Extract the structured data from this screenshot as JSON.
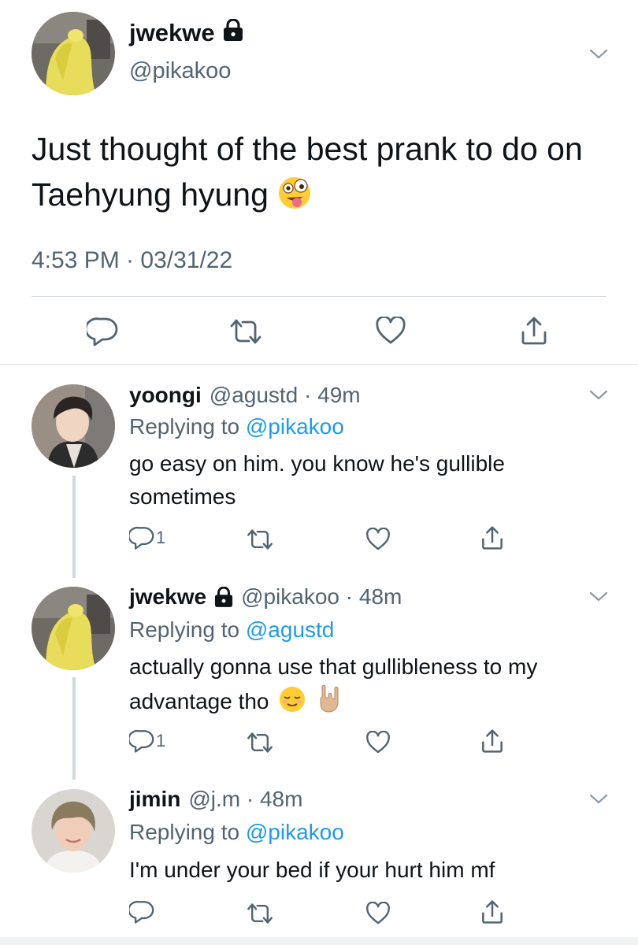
{
  "main_tweet": {
    "display_name": "jwekwe",
    "handle": "@pikakoo",
    "text": "Just thought of the best prank to do on Taehyung hyung",
    "emoji": "zany-face",
    "timestamp": "4:53 PM · 03/31/22"
  },
  "replies": [
    {
      "display_name": "yoongi",
      "handle_meta": "@agustd · 49m",
      "replying_prefix": "Replying to",
      "replying_to": "@pikakoo",
      "text": "go easy on him. you know he's gullible sometimes",
      "reply_count": "1"
    },
    {
      "display_name": "jwekwe",
      "handle_meta": "@pikakoo · 48m",
      "replying_prefix": "Replying to",
      "replying_to": "@agustd",
      "text": "actually gonna use that gullibleness to my advantage tho",
      "reply_count": "1"
    },
    {
      "display_name": "jimin",
      "handle_meta": "@j.m · 48m",
      "replying_prefix": "Replying to",
      "replying_to": "@pikakoo",
      "text": "I'm under your bed if your hurt him mf",
      "reply_count": ""
    }
  ],
  "colors": {
    "text": "#0f1419",
    "secondary": "#536471",
    "link": "#1d9bf0",
    "divider": "#d7dde1",
    "icon": "#536471"
  }
}
